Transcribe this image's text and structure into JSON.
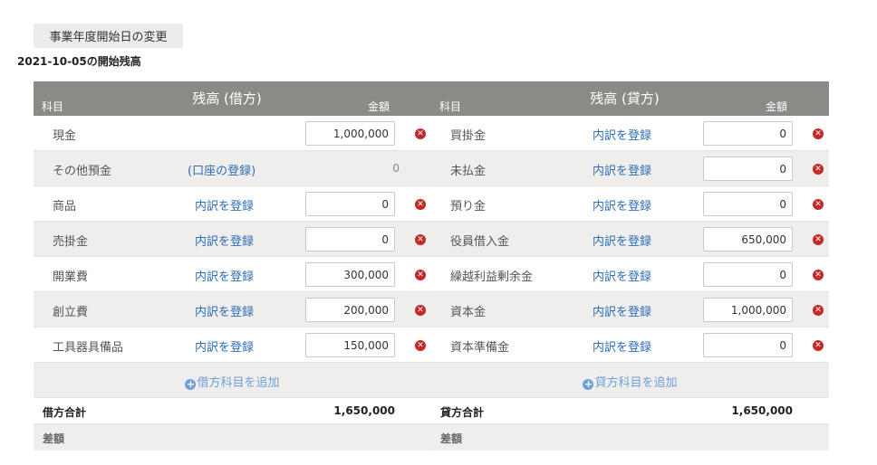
{
  "change_button": "事業年度開始日の変更",
  "opening_title": "2021-10-05の開始残高",
  "debit": {
    "title": "残高 (借方)",
    "col_subject": "科目",
    "col_amount": "金額",
    "rows": [
      {
        "account": "現金",
        "link": "",
        "value": "1,000,000",
        "input": true,
        "deletable": true
      },
      {
        "account": "その他預金",
        "link": "(口座の登録)",
        "value": "0",
        "input": false,
        "deletable": false
      },
      {
        "account": "商品",
        "link": "内訳を登録",
        "value": "0",
        "input": true,
        "deletable": true
      },
      {
        "account": "売掛金",
        "link": "内訳を登録",
        "value": "0",
        "input": true,
        "deletable": true
      },
      {
        "account": "開業費",
        "link": "内訳を登録",
        "value": "300,000",
        "input": true,
        "deletable": true
      },
      {
        "account": "創立費",
        "link": "内訳を登録",
        "value": "200,000",
        "input": true,
        "deletable": true
      },
      {
        "account": "工具器具備品",
        "link": "内訳を登録",
        "value": "150,000",
        "input": true,
        "deletable": true
      }
    ],
    "add_label": "借方科目を追加",
    "total_label": "借方合計",
    "total_value": "1,650,000",
    "diff_label": "差額"
  },
  "credit": {
    "title": "残高 (貸方)",
    "col_subject": "科目",
    "col_amount": "金額",
    "rows": [
      {
        "account": "買掛金",
        "link": "内訳を登録",
        "value": "0",
        "input": true,
        "deletable": true
      },
      {
        "account": "未払金",
        "link": "内訳を登録",
        "value": "0",
        "input": true,
        "deletable": true
      },
      {
        "account": "預り金",
        "link": "内訳を登録",
        "value": "0",
        "input": true,
        "deletable": true
      },
      {
        "account": "役員借入金",
        "link": "内訳を登録",
        "value": "650,000",
        "input": true,
        "deletable": true
      },
      {
        "account": "繰越利益剰余金",
        "link": "内訳を登録",
        "value": "0",
        "input": true,
        "deletable": true
      },
      {
        "account": "資本金",
        "link": "内訳を登録",
        "value": "1,000,000",
        "input": true,
        "deletable": true
      },
      {
        "account": "資本準備金",
        "link": "内訳を登録",
        "value": "0",
        "input": true,
        "deletable": true
      }
    ],
    "add_label": "貸方科目を追加",
    "total_label": "貸方合計",
    "total_value": "1,650,000",
    "diff_label": "差額"
  },
  "colors": {
    "header_bg": "#8c8a87",
    "row_alt": "#efeeec",
    "link": "#2d6db5",
    "delete": "#c62828",
    "add_link": "#6ea1d9"
  },
  "icons": {
    "delete": "times-circle-icon",
    "add": "plus-circle-icon"
  }
}
